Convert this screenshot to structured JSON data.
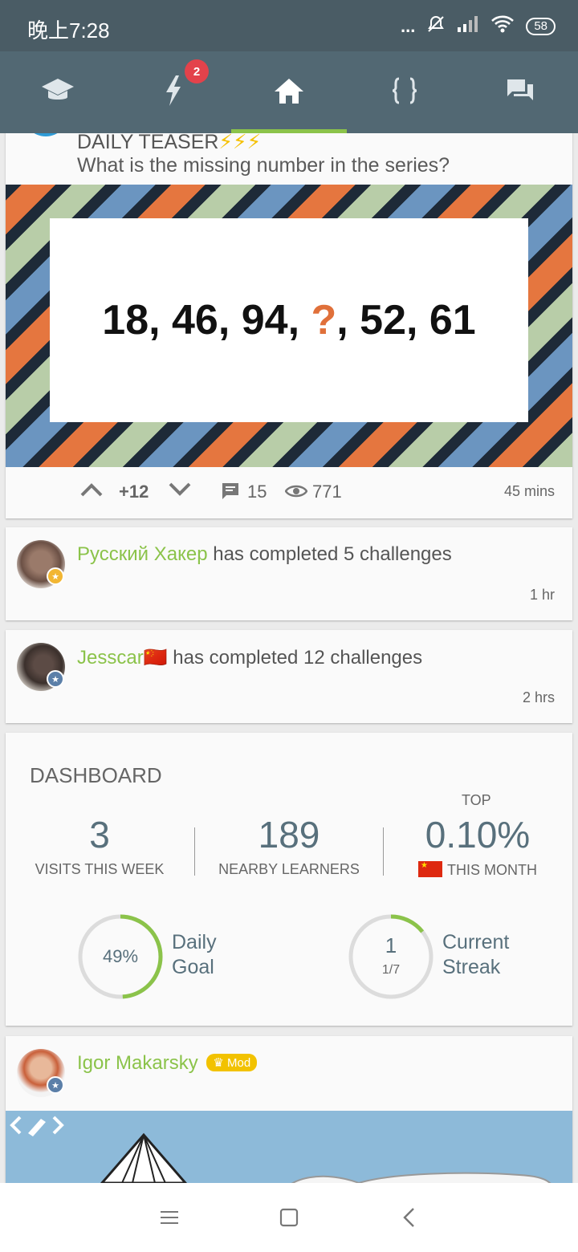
{
  "status_bar": {
    "time": "晚上7:28",
    "dots": "...",
    "battery": "58"
  },
  "nav": {
    "notifications_badge": "2"
  },
  "teaser": {
    "title": "DAILY TEASER",
    "bolts": "⚡⚡⚡",
    "question": "What is the missing number in the series?",
    "series_part1": "18, 46, 94, ",
    "series_missing": "?",
    "series_part2": ", 52, 61",
    "votes": "+12",
    "comments": "15",
    "views": "771",
    "time": "45 mins"
  },
  "feed": [
    {
      "user": "Русский Хакер",
      "text": " has completed 5 challenges",
      "time": "1 hr"
    },
    {
      "user": "Jesscar",
      "flag": "🇨🇳",
      "text": " has completed 12 challenges",
      "time": "2 hrs"
    }
  ],
  "dashboard": {
    "title": "DASHBOARD",
    "top_label": "TOP",
    "stats": [
      {
        "value": "3",
        "label": "VISITS THIS WEEK"
      },
      {
        "value": "189",
        "label": "NEARBY LEARNERS"
      },
      {
        "value": "0.10%",
        "label": "THIS MONTH"
      }
    ],
    "daily_goal": {
      "percent_text": "49%",
      "fraction": 0.49,
      "label_line1": "Daily",
      "label_line2": "Goal"
    },
    "streak": {
      "value": "1",
      "sub": "1/7",
      "fraction": 0.142857,
      "label_line1": "Current",
      "label_line2": "Streak"
    }
  },
  "post": {
    "user": "Igor Makarsky",
    "mod_label": "Mod"
  },
  "colors": {
    "accent_green": "#8bc34a",
    "nav_bg": "#526873",
    "status_bg": "#4a5c65",
    "badge_red": "#e3424b",
    "mod_yellow": "#f2c200"
  }
}
